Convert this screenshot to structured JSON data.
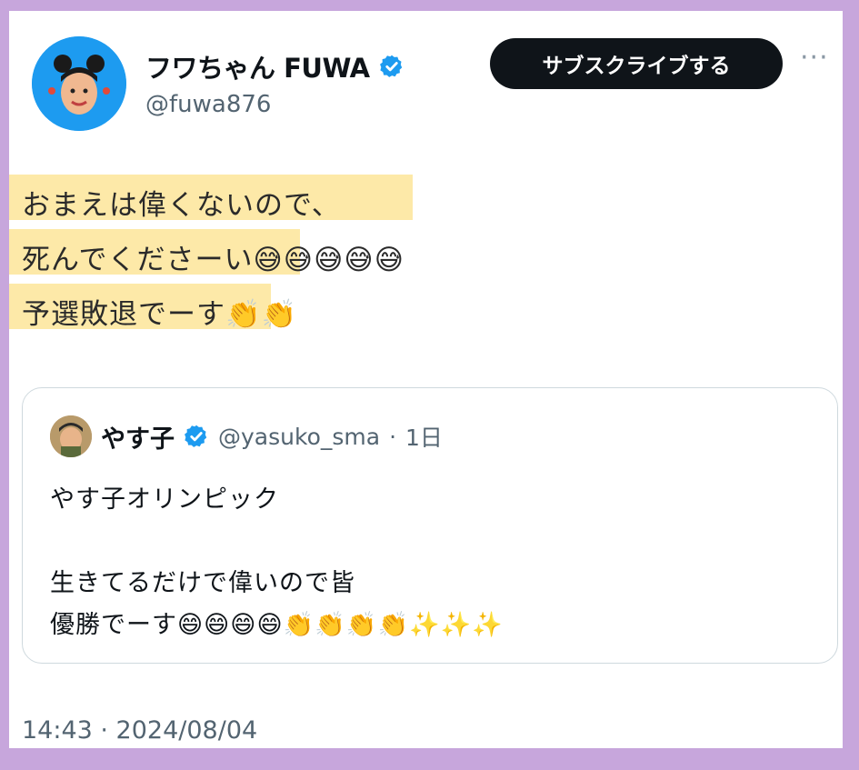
{
  "author": {
    "display_name": "フワちゃん FUWA",
    "handle": "@fuwa876"
  },
  "actions": {
    "subscribe_label": "サブスクライブする",
    "more_label": "···"
  },
  "tweet": {
    "lines": [
      {
        "text": "おまえは偉くないので、",
        "emoji": ""
      },
      {
        "text": "死んでくださーい",
        "emoji": "😅😅😅😅😅"
      },
      {
        "text": "予選敗退でーす",
        "emoji": "👏👏"
      }
    ]
  },
  "quote": {
    "display_name": "やす子",
    "handle": "@yasuko_sma",
    "separator": "·",
    "time": "1日",
    "lines": [
      "やす子オリンピック",
      "",
      "生きてるだけで偉いので皆",
      "優勝でーす😄😄😄😄👏👏👏👏✨✨✨"
    ]
  },
  "timestamp": "14:43 · 2024/08/04",
  "colors": {
    "frame": "#c7a6dc",
    "highlight": "#fde9a8",
    "verified": "#1d9bf0",
    "button": "#0f1419"
  },
  "icons": [
    "verified-badge-icon",
    "more-options-icon"
  ]
}
